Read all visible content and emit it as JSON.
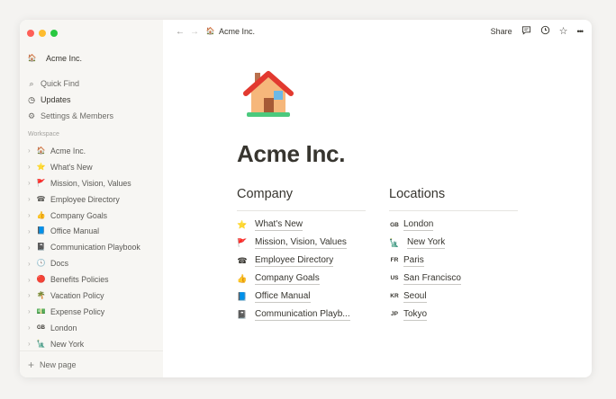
{
  "window": {
    "traffic_colors": [
      "#fe5f57",
      "#febc2e",
      "#28c840"
    ]
  },
  "sidebar": {
    "workspace_name": "Acme Inc.",
    "workspace_icon": "🏠",
    "menu": [
      {
        "icon": "search-icon",
        "glyph": "🔍",
        "label": "Quick Find"
      },
      {
        "icon": "clock-icon",
        "glyph": "🕘",
        "label": "Updates"
      },
      {
        "icon": "gear-icon",
        "glyph": "⚙",
        "label": "Settings & Members"
      }
    ],
    "section_label": "Workspace",
    "tree": [
      {
        "emoji": "🏠",
        "label": "Acme Inc."
      },
      {
        "emoji": "⭐",
        "label": "What's New"
      },
      {
        "emoji": "🚩",
        "label": "Mission, Vision, Values"
      },
      {
        "emoji": "☎",
        "label": "Employee Directory"
      },
      {
        "emoji": "👍",
        "label": "Company Goals"
      },
      {
        "emoji": "📘",
        "label": "Office Manual"
      },
      {
        "emoji": "📓",
        "label": "Communication Playbook"
      },
      {
        "emoji": "🕓",
        "label": "Docs"
      },
      {
        "emoji": "🔴",
        "label": "Benefits Policies"
      },
      {
        "emoji": "🌴",
        "label": "Vacation Policy"
      },
      {
        "emoji": "💵",
        "label": "Expense Policy"
      },
      {
        "emoji": "GB",
        "code": true,
        "label": "London"
      },
      {
        "emoji": "🗽",
        "label": "New York"
      }
    ],
    "new_page_label": "New page"
  },
  "topbar": {
    "back_glyph": "←",
    "forward_glyph": "→",
    "breadcrumb_icon": "🏠",
    "breadcrumb": "Acme Inc.",
    "share_label": "Share",
    "comment_glyph": "💬",
    "history_glyph": "🕘",
    "favorite_glyph": "☆",
    "more_glyph": "•••"
  },
  "page": {
    "title": "Acme Inc.",
    "company": {
      "heading": "Company",
      "links": [
        {
          "emoji": "⭐",
          "label": "What's New"
        },
        {
          "emoji": "🚩",
          "label": "Mission, Vision, Values"
        },
        {
          "emoji": "☎",
          "label": "Employee Directory"
        },
        {
          "emoji": "👍",
          "label": "Company Goals"
        },
        {
          "emoji": "📘",
          "label": "Office Manual"
        },
        {
          "emoji": "📓",
          "label": "Communication Playb..."
        }
      ]
    },
    "locations": {
      "heading": "Locations",
      "links": [
        {
          "emoji": "GB",
          "code": true,
          "label": "London"
        },
        {
          "emoji": "🗽",
          "label": "New York"
        },
        {
          "emoji": "FR",
          "code": true,
          "label": "Paris"
        },
        {
          "emoji": "US",
          "code": true,
          "label": "San Francisco"
        },
        {
          "emoji": "KR",
          "code": true,
          "label": "Seoul"
        },
        {
          "emoji": "JP",
          "code": true,
          "label": "Tokyo"
        }
      ]
    }
  }
}
